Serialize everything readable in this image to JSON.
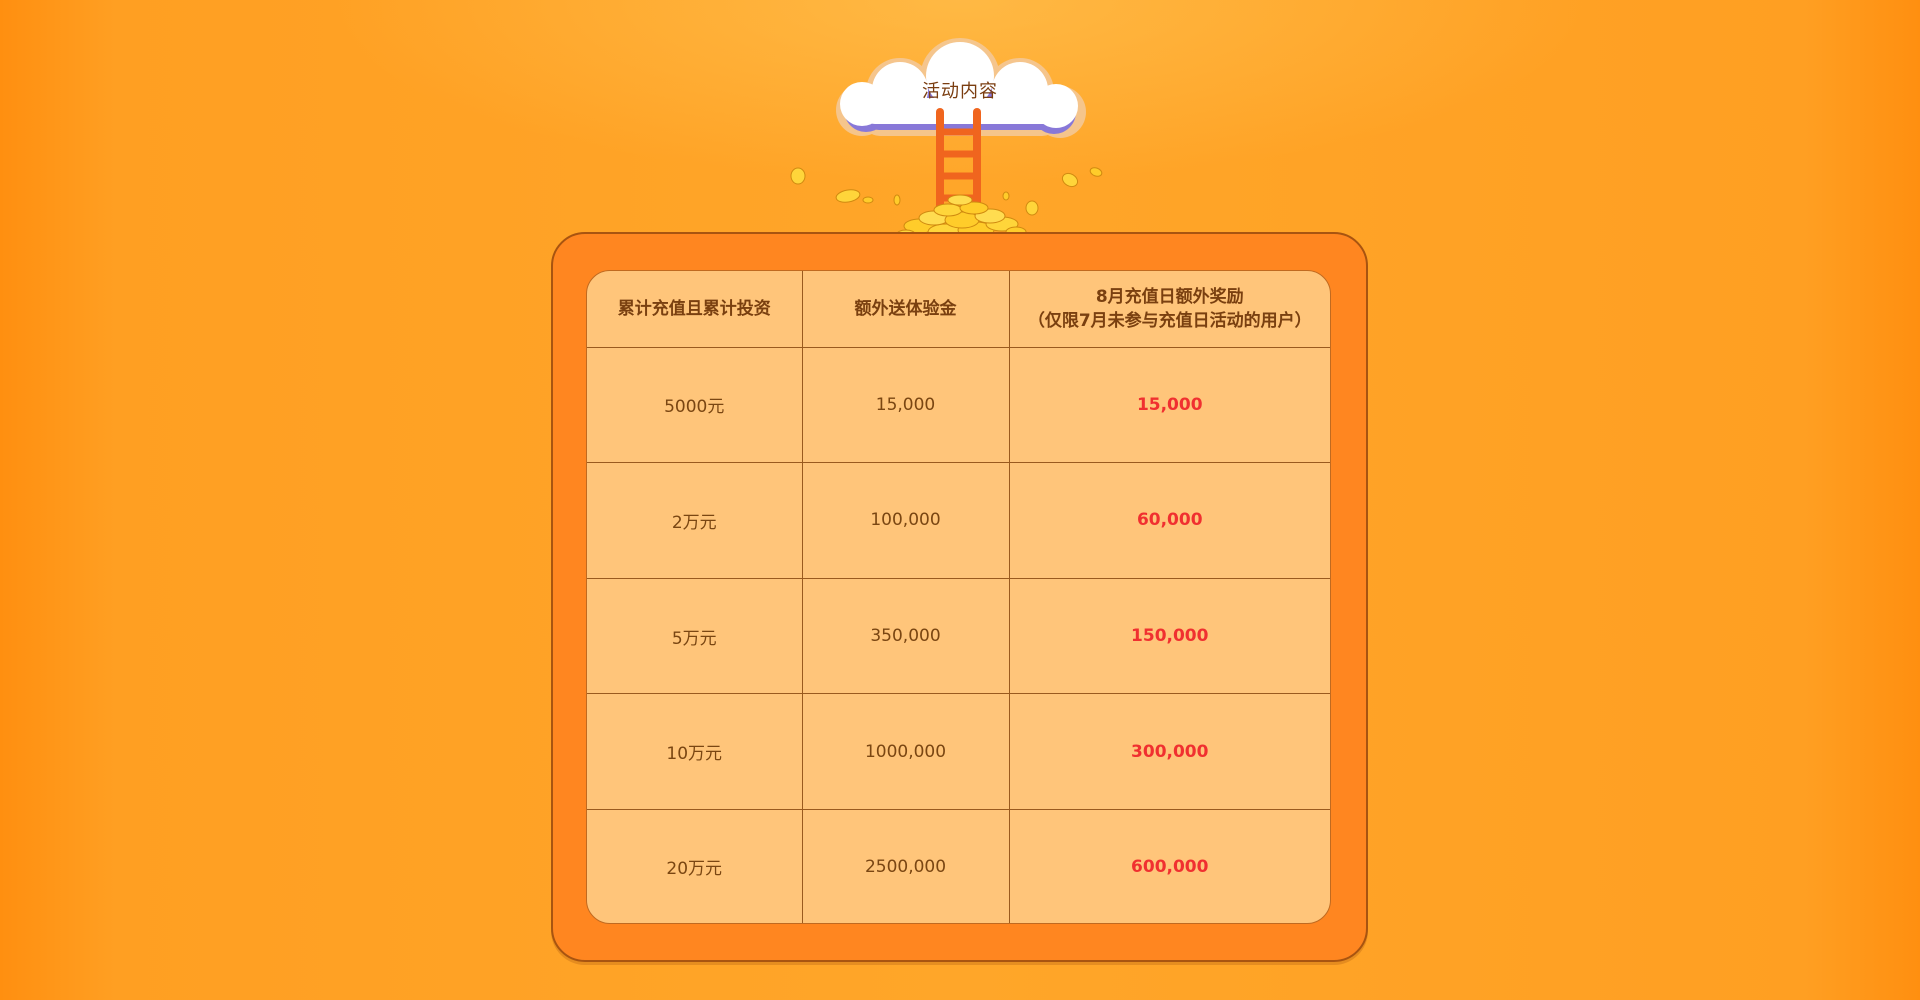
{
  "hero": {
    "title": "活动内容"
  },
  "table": {
    "headers": {
      "col1": "累计充值且累计投资",
      "col2": "额外送体验金",
      "col3_line1": "8月充值日额外奖励",
      "col3_line2": "（仅限7月未参与充值日活动的用户）"
    },
    "rows": [
      {
        "threshold": "5000元",
        "trial_gold": "15,000",
        "extra_reward": "15,000"
      },
      {
        "threshold": "2万元",
        "trial_gold": "100,000",
        "extra_reward": "60,000"
      },
      {
        "threshold": "5万元",
        "trial_gold": "350,000",
        "extra_reward": "150,000"
      },
      {
        "threshold": "10万元",
        "trial_gold": "1000,000",
        "extra_reward": "300,000"
      },
      {
        "threshold": "20万元",
        "trial_gold": "2500,000",
        "extra_reward": "600,000"
      }
    ]
  },
  "colors": {
    "background": "#ffa629",
    "board": "#ff8620",
    "table_fill": "#ffc57a",
    "header_text": "#7a4010",
    "reward_text": "#f03030"
  }
}
